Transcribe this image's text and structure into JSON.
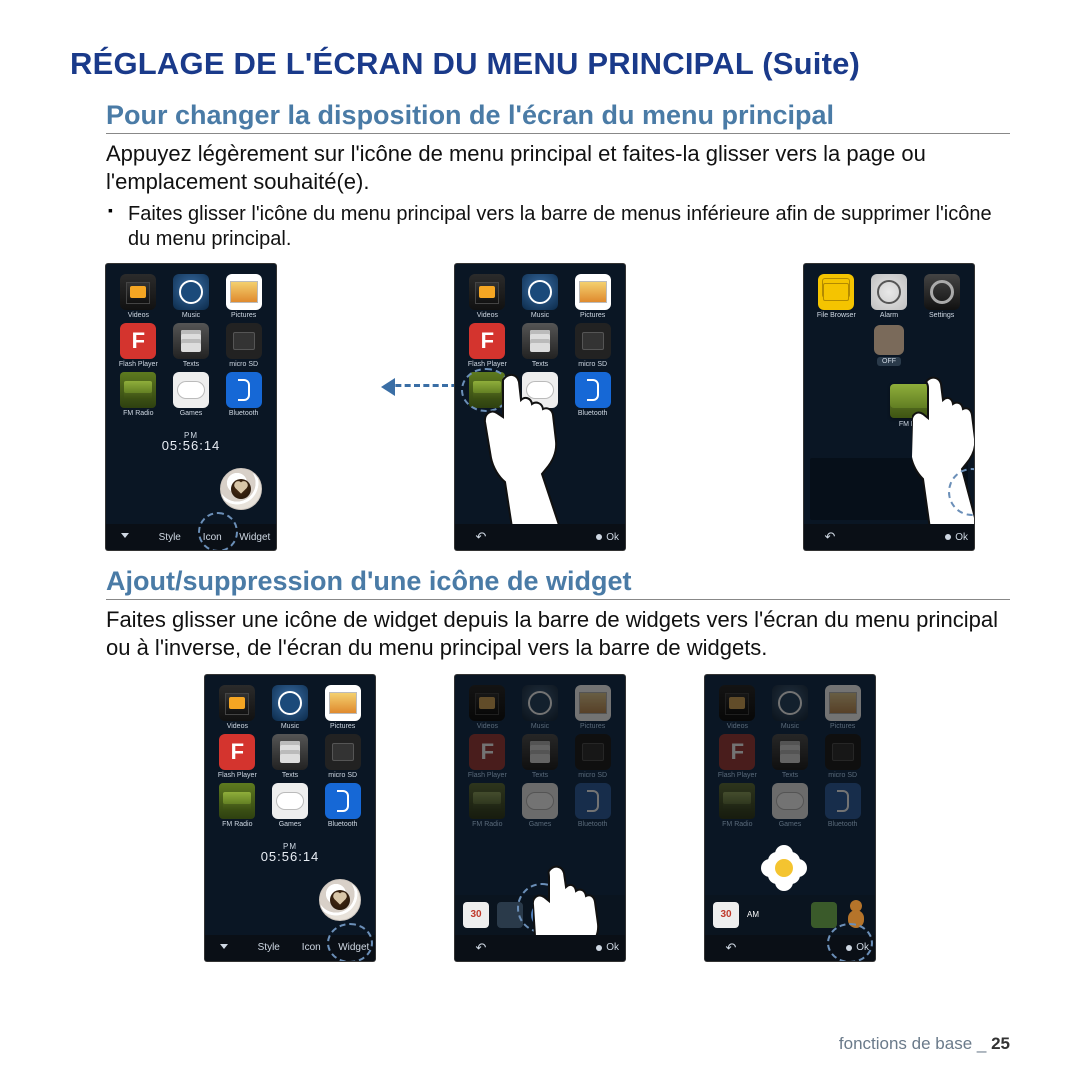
{
  "title": "RÉGLAGE DE L'ÉCRAN DU MENU PRINCIPAL (Suite)",
  "section1": {
    "heading": "Pour changer la disposition de l'écran du menu principal",
    "body": "Appuyez légèrement sur l'icône de menu principal et faites-la glisser vers la page ou l'emplacement souhaité(e).",
    "bullet": "Faites glisser l'icône du menu principal vers la barre de menus inférieure afin de supprimer l'icône du menu principal."
  },
  "section2": {
    "heading": "Ajout/suppression d'une icône de widget",
    "body": "Faites glisser une icône de widget depuis la barre de widgets vers l'écran du menu principal ou à l'inverse, de l'écran du menu principal vers la barre de widgets."
  },
  "apps": {
    "videos": "Videos",
    "music": "Music",
    "pictures": "Pictures",
    "flash": "Flash Player",
    "texts": "Texts",
    "msd": "micro SD",
    "radio": "FM Radio",
    "games": "Games",
    "bt": "Bluetooth",
    "folder": "File Browser",
    "alarm": "Alarm",
    "settings": "Settings"
  },
  "flash_letter": "F",
  "clock": {
    "pm": "PM",
    "time": "05:56:14",
    "am": "AM"
  },
  "off_label": "OFF",
  "bottombar": {
    "style": "Style",
    "icon": "Icon",
    "widget": "Widget"
  },
  "nav": {
    "ok": "Ok"
  },
  "cal_day": "30",
  "footer": {
    "text": "fonctions de base _",
    "page": "25"
  }
}
